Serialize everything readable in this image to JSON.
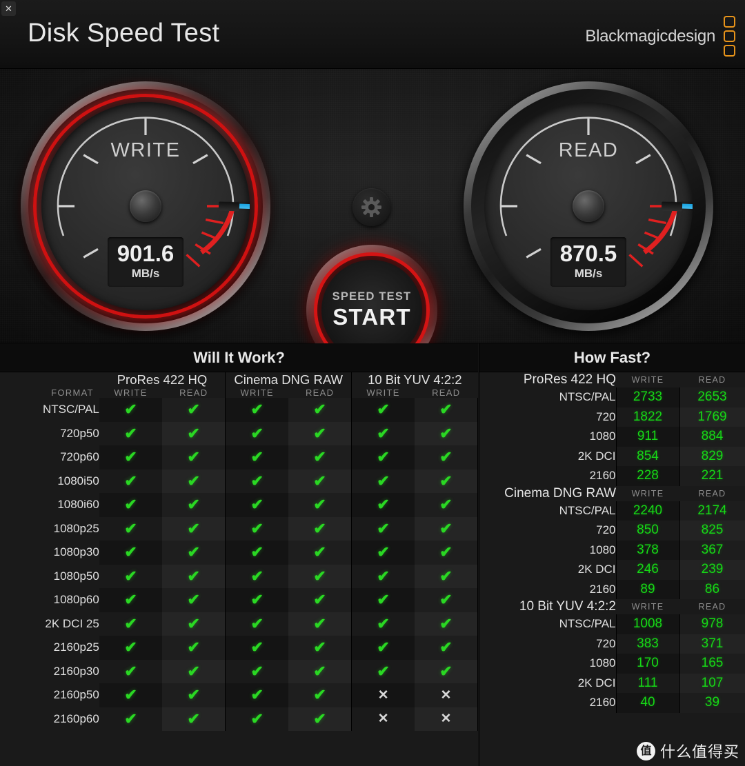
{
  "window": {
    "close_label": "✕"
  },
  "header": {
    "title": "Disk Speed Test",
    "brand": "Blackmagicdesign"
  },
  "gauges": {
    "write": {
      "label": "WRITE",
      "value": "901.6",
      "unit": "MB/s",
      "needle_angle": -178
    },
    "read": {
      "label": "READ",
      "value": "870.5",
      "unit": "MB/s",
      "needle_angle": -178
    }
  },
  "start_button": {
    "top_label": "SPEED TEST",
    "main_label": "START"
  },
  "settings_icon": "gear-icon",
  "will_it_work": {
    "title": "Will It Work?",
    "format_header": "FORMAT",
    "groups": [
      "ProRes 422 HQ",
      "Cinema DNG RAW",
      "10 Bit YUV 4:2:2"
    ],
    "sub_headers": [
      "WRITE",
      "READ"
    ],
    "check_glyph": "✔",
    "cross_glyph": "✕",
    "rows": [
      {
        "format": "NTSC/PAL",
        "cells": [
          true,
          true,
          true,
          true,
          true,
          true
        ]
      },
      {
        "format": "720p50",
        "cells": [
          true,
          true,
          true,
          true,
          true,
          true
        ]
      },
      {
        "format": "720p60",
        "cells": [
          true,
          true,
          true,
          true,
          true,
          true
        ]
      },
      {
        "format": "1080i50",
        "cells": [
          true,
          true,
          true,
          true,
          true,
          true
        ]
      },
      {
        "format": "1080i60",
        "cells": [
          true,
          true,
          true,
          true,
          true,
          true
        ]
      },
      {
        "format": "1080p25",
        "cells": [
          true,
          true,
          true,
          true,
          true,
          true
        ]
      },
      {
        "format": "1080p30",
        "cells": [
          true,
          true,
          true,
          true,
          true,
          true
        ]
      },
      {
        "format": "1080p50",
        "cells": [
          true,
          true,
          true,
          true,
          true,
          true
        ]
      },
      {
        "format": "1080p60",
        "cells": [
          true,
          true,
          true,
          true,
          true,
          true
        ]
      },
      {
        "format": "2K DCI 25",
        "cells": [
          true,
          true,
          true,
          true,
          true,
          true
        ]
      },
      {
        "format": "2160p25",
        "cells": [
          true,
          true,
          true,
          true,
          true,
          true
        ]
      },
      {
        "format": "2160p30",
        "cells": [
          true,
          true,
          true,
          true,
          true,
          true
        ]
      },
      {
        "format": "2160p50",
        "cells": [
          true,
          true,
          true,
          true,
          false,
          false
        ]
      },
      {
        "format": "2160p60",
        "cells": [
          true,
          true,
          true,
          true,
          false,
          false
        ]
      }
    ]
  },
  "how_fast": {
    "title": "How Fast?",
    "sub_headers": [
      "WRITE",
      "READ"
    ],
    "sections": [
      {
        "name": "ProRes 422 HQ",
        "rows": [
          {
            "res": "NTSC/PAL",
            "write": "2733",
            "read": "2653"
          },
          {
            "res": "720",
            "write": "1822",
            "read": "1769"
          },
          {
            "res": "1080",
            "write": "911",
            "read": "884"
          },
          {
            "res": "2K DCI",
            "write": "854",
            "read": "829"
          },
          {
            "res": "2160",
            "write": "228",
            "read": "221"
          }
        ]
      },
      {
        "name": "Cinema DNG RAW",
        "rows": [
          {
            "res": "NTSC/PAL",
            "write": "2240",
            "read": "2174"
          },
          {
            "res": "720",
            "write": "850",
            "read": "825"
          },
          {
            "res": "1080",
            "write": "378",
            "read": "367"
          },
          {
            "res": "2K DCI",
            "write": "246",
            "read": "239"
          },
          {
            "res": "2160",
            "write": "89",
            "read": "86"
          }
        ]
      },
      {
        "name": "10 Bit YUV 4:2:2",
        "rows": [
          {
            "res": "NTSC/PAL",
            "write": "1008",
            "read": "978"
          },
          {
            "res": "720",
            "write": "383",
            "read": "371"
          },
          {
            "res": "1080",
            "write": "170",
            "read": "165"
          },
          {
            "res": "2K DCI",
            "write": "111",
            "read": "107"
          },
          {
            "res": "2160",
            "write": "40",
            "read": "39"
          }
        ]
      }
    ]
  },
  "watermark": {
    "logo": "值",
    "text": "什么值得买"
  },
  "colors": {
    "accent_red": "#d41414",
    "needle_blue": "#29b0e8",
    "ok_green": "#2ad823",
    "value_green": "#16d916",
    "brand_orange": "#e8941a"
  }
}
